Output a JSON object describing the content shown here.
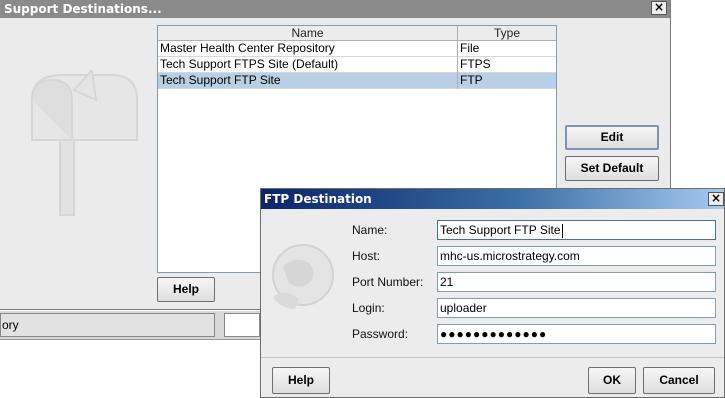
{
  "support_dialog": {
    "title": "Support Destinations...",
    "close_label": "×",
    "table": {
      "columns": [
        "Name",
        "Type"
      ],
      "rows": [
        {
          "name": "Master Health Center Repository",
          "type": "File",
          "selected": false
        },
        {
          "name": "Tech Support FTPS Site (Default)",
          "type": "FTPS",
          "selected": false
        },
        {
          "name": "Tech Support FTP Site",
          "type": "FTP",
          "selected": true
        }
      ]
    },
    "buttons": {
      "edit": "Edit",
      "set_default": "Set Default",
      "help": "Help"
    }
  },
  "background_window": {
    "field_text": "ory"
  },
  "ftp_dialog": {
    "title": "FTP Destination",
    "close_label": "×",
    "fields": {
      "name": {
        "label": "Name:",
        "value": "Tech Support FTP Site"
      },
      "host": {
        "label": "Host:",
        "value": "mhc-us.microstrategy.com"
      },
      "port": {
        "label": "Port Number:",
        "value": "21"
      },
      "login": {
        "label": "Login:",
        "value": "uploader"
      },
      "password": {
        "label": "Password:",
        "value": "●●●●●●●●●●●●●"
      }
    },
    "buttons": {
      "help": "Help",
      "ok": "OK",
      "cancel": "Cancel"
    }
  },
  "colors": {
    "selection": "#b8cfe5",
    "ftp_title_start": "#0b246a",
    "ftp_title_end": "#a6caf0",
    "back_title": "#8a8a8a"
  }
}
